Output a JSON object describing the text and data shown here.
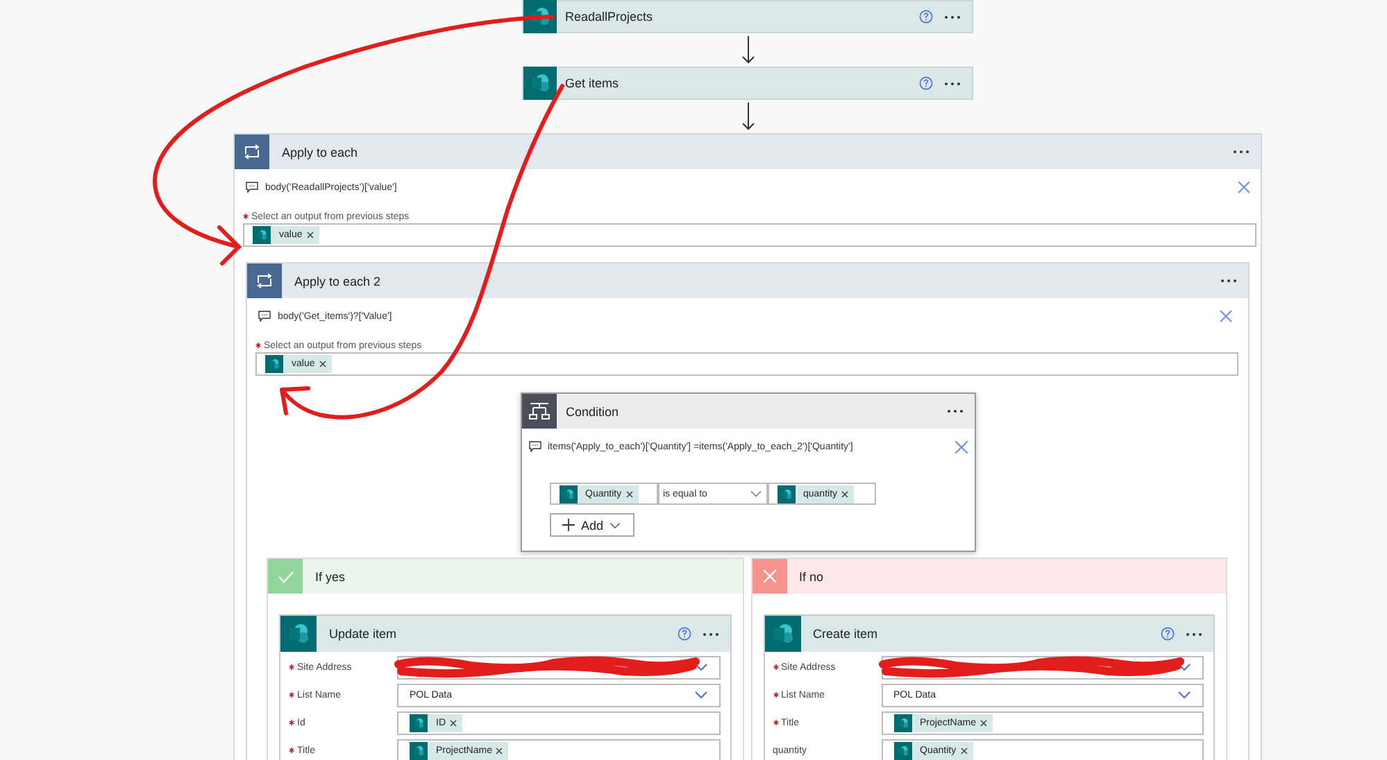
{
  "actions": [
    {
      "title": "ReadallProjects"
    },
    {
      "title": "Get items"
    }
  ],
  "apply_to_each": {
    "title": "Apply to each",
    "expression": "body('ReadallProjects')['value']",
    "field_label": "Select an output from previous steps",
    "required": true,
    "tokens": [
      "value"
    ],
    "inner": {
      "title": "Apply to each 2",
      "expression": "body('Get_items')?['Value']",
      "field_label": "Select an output from previous steps",
      "required": true,
      "tokens": [
        "value"
      ],
      "condition": {
        "title": "Condition",
        "expression": "items('Apply_to_each')['Quantity'] =items('Apply_to_each_2')['Quantity']",
        "left_token": "Quantity",
        "operator": "is equal to",
        "right_token": "quantity",
        "add_button": "Add"
      },
      "branches": [
        {
          "kind": "yes",
          "title": "If yes",
          "action": {
            "title": "Update item",
            "fields": [
              {
                "label": "Site Address",
                "required": true,
                "kind": "dropdown",
                "redacted": true
              },
              {
                "label": "List Name",
                "required": true,
                "kind": "dropdown",
                "value": "POL Data"
              },
              {
                "label": "Id",
                "required": true,
                "kind": "token",
                "tokens": [
                  "ID"
                ]
              },
              {
                "label": "Title",
                "required": true,
                "kind": "token",
                "tokens": [
                  "ProjectName"
                ]
              }
            ]
          }
        },
        {
          "kind": "no",
          "title": "If no",
          "action": {
            "title": "Create item",
            "fields": [
              {
                "label": "Site Address",
                "required": true,
                "kind": "dropdown",
                "redacted": true
              },
              {
                "label": "List Name",
                "required": true,
                "kind": "dropdown",
                "value": "POL Data"
              },
              {
                "label": "Title",
                "required": true,
                "kind": "token",
                "tokens": [
                  "ProjectName"
                ]
              },
              {
                "label": "quantity",
                "required": false,
                "kind": "token",
                "tokens": [
                  "Quantity"
                ]
              }
            ]
          }
        }
      ]
    }
  }
}
